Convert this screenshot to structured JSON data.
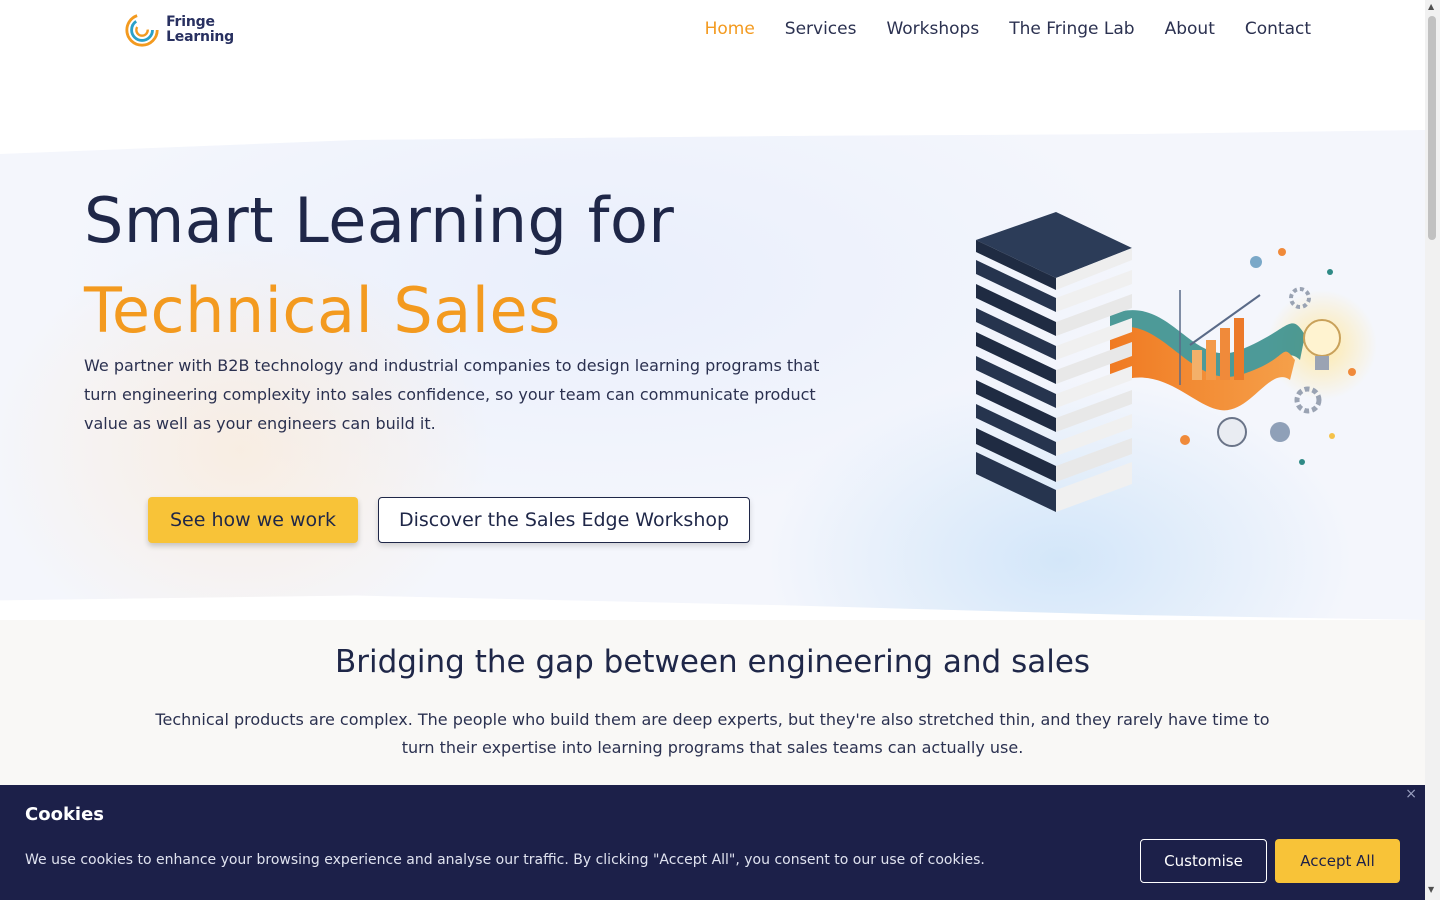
{
  "brand": {
    "line1": "Fringe",
    "line2": "Learning"
  },
  "nav": {
    "items": [
      {
        "label": "Home",
        "active": true
      },
      {
        "label": "Services"
      },
      {
        "label": "Workshops"
      },
      {
        "label": "The Fringe Lab"
      },
      {
        "label": "About"
      },
      {
        "label": "Contact"
      }
    ]
  },
  "hero": {
    "title_line1": "Smart Learning for",
    "title_line2": "Technical Sales",
    "description": "We partner with B2B technology and industrial companies to design learning programs that turn engineering complexity into sales confidence, so your team can communicate product value as well as your engineers can build it.",
    "primary_button": "See how we work",
    "secondary_button": "Discover the Sales Edge Workshop"
  },
  "section": {
    "title": "Bridging the gap between engineering and sales",
    "description": "Technical products are complex. The people who build them are deep experts, but they're also stretched thin, and they rarely have time to turn their expertise into learning programs that sales teams can actually use."
  },
  "cookies": {
    "title": "Cookies",
    "text": "We use cookies to enhance your browsing experience and analyse our traffic. By clicking \"Accept All\", you consent to our use of cookies.",
    "customise": "Customise",
    "accept": "Accept All",
    "close": "×"
  },
  "colors": {
    "accent": "#f39a1f",
    "navy": "#1f2748",
    "button": "#f8c338",
    "banner": "#1c2049"
  }
}
